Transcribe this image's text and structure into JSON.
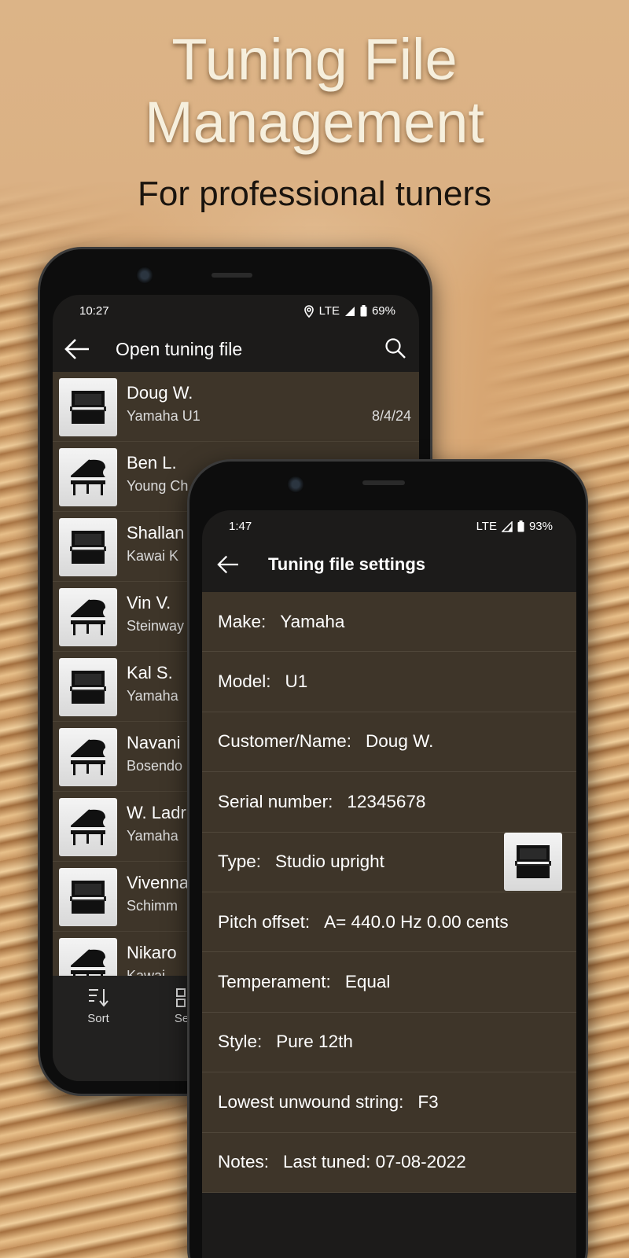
{
  "hero": {
    "title_line1": "Tuning File",
    "title_line2": "Management",
    "subtitle": "For professional tuners"
  },
  "back_phone": {
    "status": {
      "time": "10:27",
      "network": "LTE",
      "battery": "69%"
    },
    "appbar": {
      "title": "Open tuning file"
    },
    "files": [
      {
        "name": "Doug W.",
        "sub": "Yamaha  U1",
        "date": "8/4/24",
        "icon": "upright-piano-icon"
      },
      {
        "name": "Ben L.",
        "sub": "Young Ch",
        "date": "",
        "icon": "grand-piano-icon"
      },
      {
        "name": "Shallan",
        "sub": "Kawai  K",
        "date": "",
        "icon": "upright-piano-icon"
      },
      {
        "name": "Vin V.",
        "sub": "Steinway",
        "date": "",
        "icon": "grand-piano-icon"
      },
      {
        "name": "Kal S.",
        "sub": "Yamaha",
        "date": "",
        "icon": "upright-piano-icon"
      },
      {
        "name": "Navani",
        "sub": "Bosendo",
        "date": "",
        "icon": "grand-piano-icon"
      },
      {
        "name": "W. Ladr",
        "sub": "Yamaha",
        "date": "",
        "icon": "grand-piano-icon"
      },
      {
        "name": "Vivenna",
        "sub": "Schimm",
        "date": "",
        "icon": "upright-piano-icon"
      },
      {
        "name": "Nikaro",
        "sub": "Kawai",
        "date": "",
        "icon": "grand-piano-icon"
      }
    ],
    "bottom": {
      "sort_label": "Sort",
      "select_label": "Se"
    }
  },
  "front_phone": {
    "status": {
      "time": "1:47",
      "network": "LTE",
      "battery": "93%"
    },
    "appbar": {
      "title": "Tuning file settings"
    },
    "settings": [
      {
        "label": "Make:",
        "value": "Yamaha"
      },
      {
        "label": "Model:",
        "value": "U1"
      },
      {
        "label": "Customer/Name:",
        "value": "Doug W."
      },
      {
        "label": "Serial number:",
        "value": "12345678"
      },
      {
        "label": "Type:",
        "value": "Studio upright",
        "icon": "upright-piano-icon"
      },
      {
        "label": "Pitch offset:",
        "value": "A= 440.0 Hz   0.00 cents"
      },
      {
        "label": "Temperament:",
        "value": "Equal"
      },
      {
        "label": "Style:",
        "value": "Pure 12th"
      },
      {
        "label": "Lowest unwound string:",
        "value": "F3"
      },
      {
        "label": "Notes:",
        "value": "Last tuned: 07-08-2022"
      }
    ]
  },
  "colors": {
    "list_bg": "#3e3529",
    "appbar_bg": "#1c1b1a",
    "hero_title": "#f6efdd"
  }
}
